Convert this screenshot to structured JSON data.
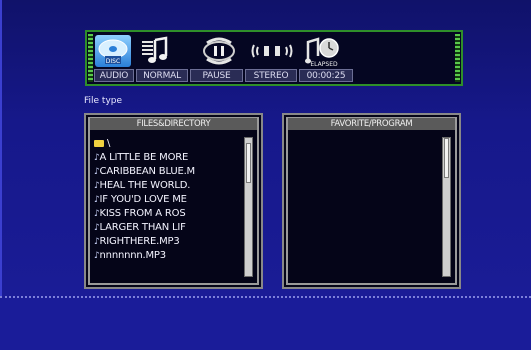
{
  "status_bar": {
    "disc_badge": "DISC",
    "labels": [
      "AUDIO",
      "NORMAL",
      "PAUSE",
      "STEREO",
      "00:00:25"
    ],
    "elapsed_caption": "ELAPSED",
    "icons": [
      "disc-icon",
      "music-notes-icon",
      "pause-loop-icon",
      "stereo-speaker-icon",
      "elapsed-clock-icon"
    ]
  },
  "file_type_label": "File type",
  "files_panel": {
    "title": "FILES&DIRECTORY",
    "items": [
      {
        "type": "folder",
        "name": "\\"
      },
      {
        "type": "file",
        "name": "A LITTLE BE MORE"
      },
      {
        "type": "file",
        "name": "CARIBBEAN BLUE.M"
      },
      {
        "type": "file",
        "name": "HEAL THE WORLD."
      },
      {
        "type": "file",
        "name": "IF YOU'D LOVE ME"
      },
      {
        "type": "file",
        "name": "KISS FROM A ROS"
      },
      {
        "type": "file",
        "name": "LARGER THAN LIF"
      },
      {
        "type": "file",
        "name": "RIGHTHERE.MP3"
      },
      {
        "type": "file",
        "name": "nnnnnnn.MP3"
      }
    ],
    "scroll_position": 0.05
  },
  "program_panel": {
    "title": "FAVORITE/PROGRAM",
    "items": [],
    "scroll_position": 0.0
  },
  "colors": {
    "background": "#16188a",
    "panel_border_green": "#2f8f2a",
    "folder": "#f0d140"
  }
}
